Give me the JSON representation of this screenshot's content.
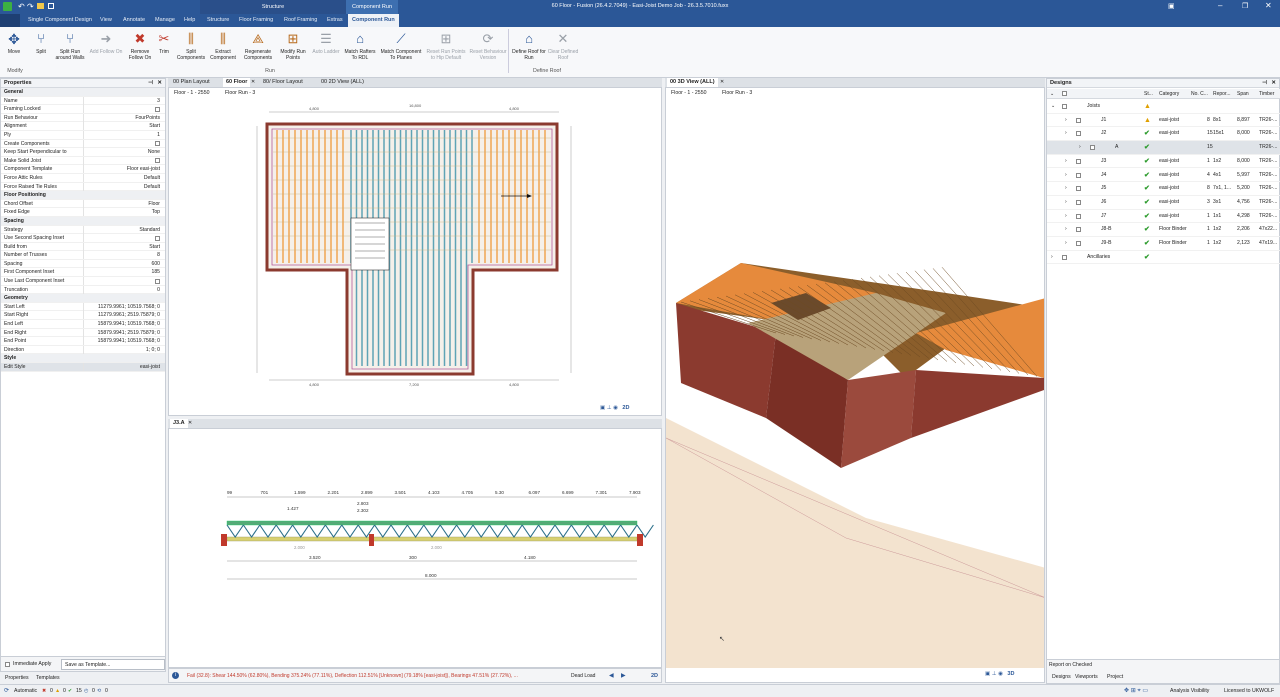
{
  "window": {
    "title": "60 Floor - Fusion (26.4.2.7049) - Easi-Joist Demo Job - 26.3.5.7010.fuxx"
  },
  "context_headers": {
    "structure": "Structure",
    "component_run": "Component Run"
  },
  "ribbon_tabs": [
    "Single Component Design",
    "View",
    "Annotate",
    "Manage",
    "Help",
    "Structure",
    "Floor Framing",
    "Roof Framing",
    "Extras",
    "Component Run"
  ],
  "ribbon_buttons": [
    {
      "label": "Move",
      "enabled": true
    },
    {
      "label": "Split",
      "enabled": true
    },
    {
      "label": "Split Run around Walls",
      "enabled": true
    },
    {
      "label": "Add Follow On",
      "enabled": false
    },
    {
      "label": "Remove Follow On",
      "enabled": true
    },
    {
      "label": "Trim",
      "enabled": true
    },
    {
      "label": "Split Components",
      "enabled": true
    },
    {
      "label": "Extract Component",
      "enabled": true
    },
    {
      "label": "Regenerate Components",
      "enabled": true
    },
    {
      "label": "Modify Run Points",
      "enabled": true
    },
    {
      "label": "Auto Ladder",
      "enabled": false
    },
    {
      "label": "Match Rafters To RDL",
      "enabled": true
    },
    {
      "label": "Match Component To Planes",
      "enabled": true
    },
    {
      "label": "Reset Run Points to Hip Default",
      "enabled": false
    },
    {
      "label": "Reset Behaviour Version",
      "enabled": false
    },
    {
      "label": "Define Roof for Run",
      "enabled": true
    },
    {
      "label": "Clear Defined Roof",
      "enabled": false
    }
  ],
  "ribbon_groups": {
    "modify": "Modify",
    "run": "Run",
    "define_roof": "Define Roof"
  },
  "properties": {
    "title": "Properties",
    "rows": [
      {
        "k": "General",
        "sec": true
      },
      {
        "k": "Name",
        "v": "3"
      },
      {
        "k": "Framing Locked",
        "cb": true
      },
      {
        "k": "Run Behaviour",
        "v": "FourPoints"
      },
      {
        "k": "Alignment",
        "v": "Start"
      },
      {
        "k": "Ply",
        "v": "1"
      },
      {
        "k": "Create Components",
        "cb": true
      },
      {
        "k": "Keep Start Perpendicular to",
        "v": "None"
      },
      {
        "k": "Make Solid Joist",
        "cb": true
      },
      {
        "k": "Component Template",
        "v": "Floor easi-joist"
      },
      {
        "k": "Force Attic Rules",
        "v": "Default"
      },
      {
        "k": "Force Raised Tie Rules",
        "v": "Default"
      },
      {
        "k": "Floor Positioning",
        "sec": true
      },
      {
        "k": "Chord Offset",
        "v": "Floor"
      },
      {
        "k": "Fixed Edge",
        "v": "Top"
      },
      {
        "k": "Spacing",
        "sec": true
      },
      {
        "k": "Strategy",
        "v": "Standard"
      },
      {
        "k": "Use Second Spacing Inset",
        "cb": true
      },
      {
        "k": "Build from",
        "v": "Start"
      },
      {
        "k": "Number of Trusses",
        "v": "8"
      },
      {
        "k": "Spacing",
        "v": "600"
      },
      {
        "k": "First Component Inset",
        "v": "185"
      },
      {
        "k": "Use Last Component Inset",
        "cb": true
      },
      {
        "k": "Truncation",
        "v": "0"
      },
      {
        "k": "Geometry",
        "sec": true
      },
      {
        "k": "Start Left",
        "v": "11279.9961; 10519.7568; 0"
      },
      {
        "k": "Start Right",
        "v": "11279.9961; 2519.75879; 0"
      },
      {
        "k": "End Left",
        "v": "15879.9941; 10519.7568; 0"
      },
      {
        "k": "End Right",
        "v": "15879.9941; 2519.75879; 0"
      },
      {
        "k": "End Point",
        "v": "15879.9941; 10519.7568; 0"
      },
      {
        "k": "Direction",
        "v": "1; 0; 0"
      },
      {
        "k": "Style",
        "sec": true
      },
      {
        "k": "Edit Style",
        "v": "easi-joist"
      }
    ],
    "immediate_apply": "Immediate Apply",
    "save_template": "Save as Template...",
    "tabs": [
      "Properties",
      "Templates"
    ]
  },
  "doc_tabs": [
    "00 Plan Layout",
    "60 Floor",
    "80/ Floor Layout",
    "00 2D View (ALL)"
  ],
  "plan_view": {
    "crumb1": "Floor - 1 - 2550",
    "crumb2": "Floor Run - 3",
    "dims_top": [
      "4,800",
      "16,800",
      "4,800"
    ],
    "dims_bottom": [
      "4,800",
      "7,200",
      "4,800"
    ]
  },
  "view3d": {
    "tab": "00 3D View (ALL)",
    "crumb1": "Floor - 1 - 2550",
    "crumb2": "Floor Run - 3",
    "mode": "3D"
  },
  "joist_view": {
    "tab": "J3.A",
    "top_dims": [
      "99",
      "701",
      "1.599",
      "2.201",
      "2.899",
      "3.501",
      "4.103",
      "4.705",
      "5.30",
      "6.097",
      "6.699",
      "7.301",
      "7.903"
    ],
    "sub_dims": [
      "1.427",
      "2.803",
      "2.302"
    ],
    "bottom_dims": [
      "3.520",
      "300",
      "4.180"
    ],
    "total": "8.000",
    "inner": [
      "2.000",
      "2.000"
    ]
  },
  "view_mode": "2D",
  "status_bar": {
    "text": "Fail (32.8): Shear 144.50% (62.80%), Bending 375.24% (77.11%), Deflection 112.51% [Unknown] (79.18% [easi-joist]), Bearings 47.51% (27.72%), ...",
    "load": "Dead Load"
  },
  "designs": {
    "title": "Designs",
    "columns": [
      "St...",
      "Category",
      "No. C...",
      "Repor...",
      "Span",
      "Timber"
    ],
    "rows": [
      {
        "indent": 0,
        "name": "Joists",
        "status": "warn",
        "cat": "",
        "no": "",
        "rep": "",
        "span": "",
        "timber": ""
      },
      {
        "indent": 1,
        "name": "J1",
        "status": "warn",
        "cat": "easi-joist",
        "no": "8",
        "rep": "8x1",
        "span": "8,897",
        "timber": "TR26-..."
      },
      {
        "indent": 1,
        "name": "J2",
        "status": "ok",
        "cat": "easi-joist",
        "no": "15",
        "rep": "15x1",
        "span": "8,000",
        "timber": "TR26-..."
      },
      {
        "indent": 2,
        "name": "A",
        "status": "ok",
        "cat": "",
        "no": "15",
        "rep": "",
        "span": "",
        "timber": "TR26-...",
        "sel": true
      },
      {
        "indent": 1,
        "name": "J3",
        "status": "ok",
        "cat": "easi-joist",
        "no": "1",
        "rep": "1x2",
        "span": "8,000",
        "timber": "TR26-..."
      },
      {
        "indent": 1,
        "name": "J4",
        "status": "ok",
        "cat": "easi-joist",
        "no": "4",
        "rep": "4x1",
        "span": "5,997",
        "timber": "TR26-..."
      },
      {
        "indent": 1,
        "name": "J5",
        "status": "ok",
        "cat": "easi-joist",
        "no": "8",
        "rep": "7x1, 1...",
        "span": "5,200",
        "timber": "TR26-..."
      },
      {
        "indent": 1,
        "name": "J6",
        "status": "ok",
        "cat": "easi-joist",
        "no": "3",
        "rep": "3x1",
        "span": "4,756",
        "timber": "TR26-..."
      },
      {
        "indent": 1,
        "name": "J7",
        "status": "ok",
        "cat": "easi-joist",
        "no": "1",
        "rep": "1x1",
        "span": "4,298",
        "timber": "TR26-..."
      },
      {
        "indent": 1,
        "name": "J8-B",
        "status": "ok",
        "cat": "Floor Binder",
        "no": "1",
        "rep": "1x2",
        "span": "2,206",
        "timber": "47x22..."
      },
      {
        "indent": 1,
        "name": "J9-B",
        "status": "ok",
        "cat": "Floor Binder",
        "no": "1",
        "rep": "1x2",
        "span": "2,123",
        "timber": "47x19..."
      },
      {
        "indent": 0,
        "name": "Ancillaries",
        "status": "ok",
        "cat": "",
        "no": "",
        "rep": "",
        "span": "",
        "timber": ""
      }
    ],
    "report": "Report on Checked",
    "tabs": [
      "Designs",
      "Viewports",
      "Project"
    ]
  },
  "bottom_status": {
    "mode": "Automatic",
    "c1": "0",
    "c2": "0",
    "c3": "15",
    "c4": "0",
    "c5": "0",
    "analysis": "Analysis Visibility",
    "licence": "Licensed to UKWOLF"
  },
  "colors": {
    "accent": "#2b5797",
    "orange": "#f0a552",
    "teal": "#5fa3b5",
    "brick": "#8b3a2f"
  }
}
